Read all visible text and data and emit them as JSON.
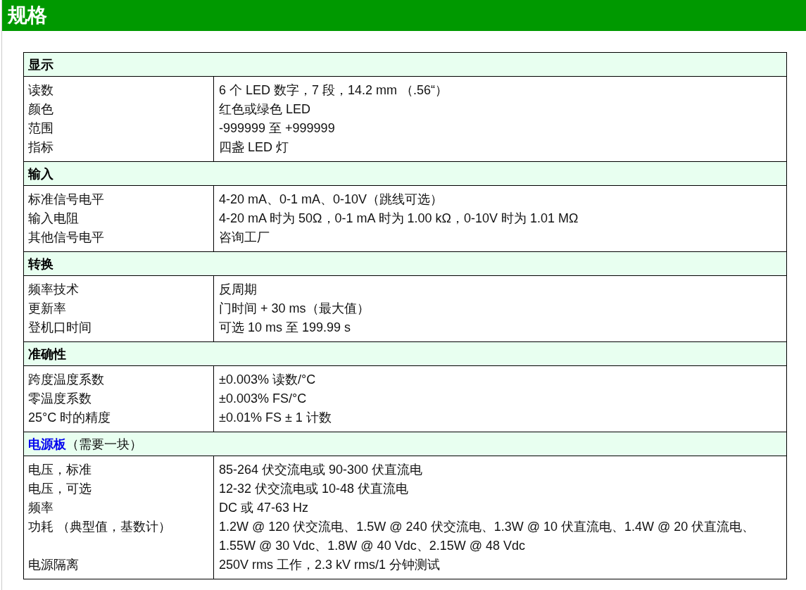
{
  "page_title": "规格",
  "sections": [
    {
      "title": "显示",
      "link": false,
      "rows": [
        {
          "label": "读数",
          "value": "6 个 LED 数字，7 段，14.2 mm （.56“）"
        },
        {
          "label": "颜色",
          "value": "红色或绿色 LED"
        },
        {
          "label": "范围",
          "value": "-999999 至 +999999"
        },
        {
          "label": "指标",
          "value": "四盏 LED 灯"
        }
      ]
    },
    {
      "title": "输入",
      "link": false,
      "rows": [
        {
          "label": "标准信号电平",
          "value": "4-20 mA、0-1 mA、0-10V（跳线可选）"
        },
        {
          "label": "输入电阻",
          "value": "4-20 mA 时为 50Ω，0-1 mA 时为 1.00 kΩ，0-10V 时为 1.01 MΩ"
        },
        {
          "label": "其他信号电平",
          "value": "咨询工厂"
        }
      ]
    },
    {
      "title": "转换",
      "link": false,
      "rows": [
        {
          "label": "频率技术",
          "value": "反周期"
        },
        {
          "label": "更新率",
          "value": "门时间 + 30 ms（最大值）"
        },
        {
          "label": "登机口时间",
          "value": "可选 10 ms 至 199.99 s"
        }
      ]
    },
    {
      "title": "准确性",
      "link": false,
      "rows": [
        {
          "label": "跨度温度系数",
          "value": "±0.003% 读数/°C"
        },
        {
          "label": "零温度系数",
          "value": "±0.003% FS/°C"
        },
        {
          "label": "25°C 时的精度",
          "value": "±0.01% FS ± 1 计数"
        }
      ]
    },
    {
      "title": "电源板",
      "link": true,
      "note": "（需要一块）",
      "rows": [
        {
          "label": "电压，标准",
          "value": "85-264 伏交流电或 90-300 伏直流电"
        },
        {
          "label": "电压，可选",
          "value": "12-32 伏交流电或 10-48 伏直流电"
        },
        {
          "label": "频率",
          "value": "DC 或 47-63 Hz"
        },
        {
          "label": "功耗 （典型值，基数计）",
          "value": "1.2W @ 120 伏交流电、1.5W @ 240 伏交流电、1.3W @ 10 伏直流电、1.4W @ 20 伏直流电、 1.55W @ 30 Vdc、1.8W @ 40 Vdc、2.15W @ 48 Vdc"
        },
        {
          "label": "电源隔离",
          "value": "250V rms 工作，2.3 kV rms/1 分钟测试"
        }
      ]
    }
  ]
}
